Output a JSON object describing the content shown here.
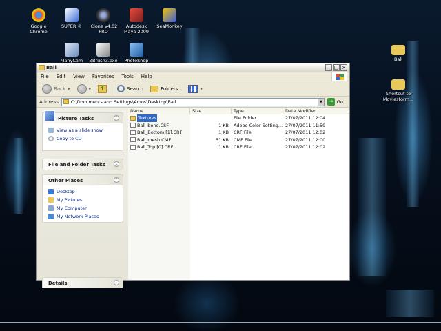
{
  "desktop": {
    "icons": [
      {
        "label": "Google\nChrome",
        "color": "#e84c3d"
      },
      {
        "label": "SUPER ©",
        "color": "#3a6ed8"
      },
      {
        "label": "iClone v4.02\nPRO",
        "color": "#3a3a3a"
      },
      {
        "label": "Autodesk\nMaya 2009",
        "color": "#c0392b"
      },
      {
        "label": "SeaMonkey",
        "color": "#3b5bdb"
      },
      {
        "label": "ManyCam",
        "color": "#6c8ebf"
      },
      {
        "label": "ZBrush3.exe",
        "color": "#eeeeee"
      },
      {
        "label": "PhotoShop",
        "color": "#1f5fa8"
      },
      {
        "label": "Ball",
        "color": "#e8c85a"
      },
      {
        "label": "Shortcut to\nMoviestorm...",
        "color": "#e8c85a"
      }
    ]
  },
  "window": {
    "title": "Ball",
    "buttons": {
      "minimize": "_",
      "maximize": "□",
      "close": "×"
    },
    "menu": [
      "File",
      "Edit",
      "View",
      "Favorites",
      "Tools",
      "Help"
    ],
    "toolbar": {
      "back": "Back",
      "search": "Search",
      "folders": "Folders"
    },
    "address": {
      "label": "Address",
      "path": "C:\\Documents and Settings\\Amos\\Desktop\\Ball",
      "go": "Go"
    },
    "tasks": {
      "picture_tasks": {
        "title": "Picture Tasks",
        "items": [
          "View as a slide show",
          "Copy to CD"
        ]
      },
      "file_folder_tasks": {
        "title": "File and Folder Tasks"
      },
      "other_places": {
        "title": "Other Places",
        "items": [
          "Desktop",
          "My Pictures",
          "My Computer",
          "My Network Places"
        ]
      },
      "details": {
        "title": "Details"
      }
    },
    "columns": [
      "Name",
      "Size",
      "Type",
      "Date Modified"
    ],
    "files": [
      {
        "name": "Textures",
        "size": "",
        "type": "File Folder",
        "date": "27/07/2011 12:04",
        "icon": "folder"
      },
      {
        "name": "Ball_bone.CSF",
        "size": "1 KB",
        "type": "Adobe Color Setting...",
        "date": "27/07/2011 11:59",
        "icon": "file"
      },
      {
        "name": "Ball_Bottom [1].CRF",
        "size": "1 KB",
        "type": "CRF File",
        "date": "27/07/2011 12:02",
        "icon": "file"
      },
      {
        "name": "Ball_mesh.CMF",
        "size": "51 KB",
        "type": "CMF File",
        "date": "27/07/2011 12:00",
        "icon": "file"
      },
      {
        "name": "Ball_Top [0].CRF",
        "size": "1 KB",
        "type": "CRF File",
        "date": "27/07/2011 12:02",
        "icon": "file"
      }
    ]
  },
  "colors": {
    "selection": "#316ac5",
    "link": "#0b2a8a",
    "folder": "#e8c85a"
  }
}
